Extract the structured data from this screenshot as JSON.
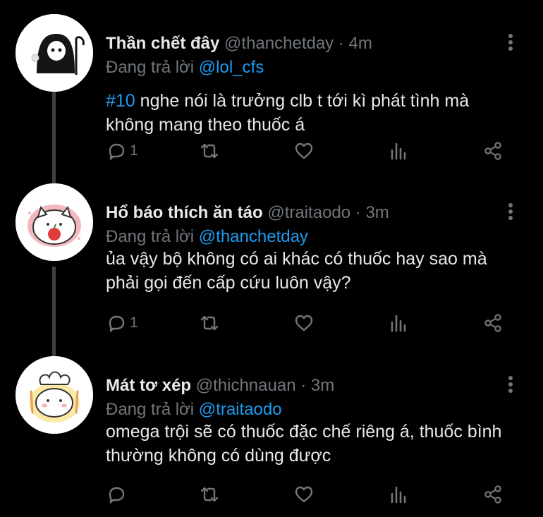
{
  "tweets": [
    {
      "name": "Thần chết đây",
      "handle": "@thanchetday",
      "separator": "·",
      "time": "4m",
      "replying_prefix": "Đang trả lời",
      "replying_to": "@lol_cfs",
      "hashtag": "#10",
      "text": " nghe nói là trưởng clb t tới kì phát tình mà không mang theo thuốc á",
      "reply_count": "1",
      "avatar": "grim-reaper-ghost"
    },
    {
      "name": "Hổ báo thích ăn táo",
      "handle": "@traitaodo",
      "separator": "·",
      "time": "3m",
      "replying_prefix": "Đang trả lời",
      "replying_to": "@thanchetday",
      "hashtag": "",
      "text": "ủa vậy bộ không có ai khác có thuốc hay sao mà phải gọi đến cấp cứu luôn vậy?",
      "reply_count": "1",
      "avatar": "cat-holding-apple"
    },
    {
      "name": "Mát tơ xép",
      "handle": "@thichnauan",
      "separator": "·",
      "time": "3m",
      "replying_prefix": "Đang trả lời",
      "replying_to": "@traitaodo",
      "hashtag": "",
      "text": "omega trội sẽ có thuốc đặc chế riêng á, thuốc bình thường không có dùng được",
      "reply_count": "",
      "avatar": "chef-bear"
    }
  ],
  "icons": [
    "reply-icon",
    "retweet-icon",
    "like-icon",
    "stats-icon",
    "share-icon",
    "more-icon"
  ],
  "colors": {
    "background": "#000000",
    "text": "#e7e9ea",
    "secondary": "#71767b",
    "accent": "#1d9bf0",
    "thread_line": "#3e4144"
  }
}
